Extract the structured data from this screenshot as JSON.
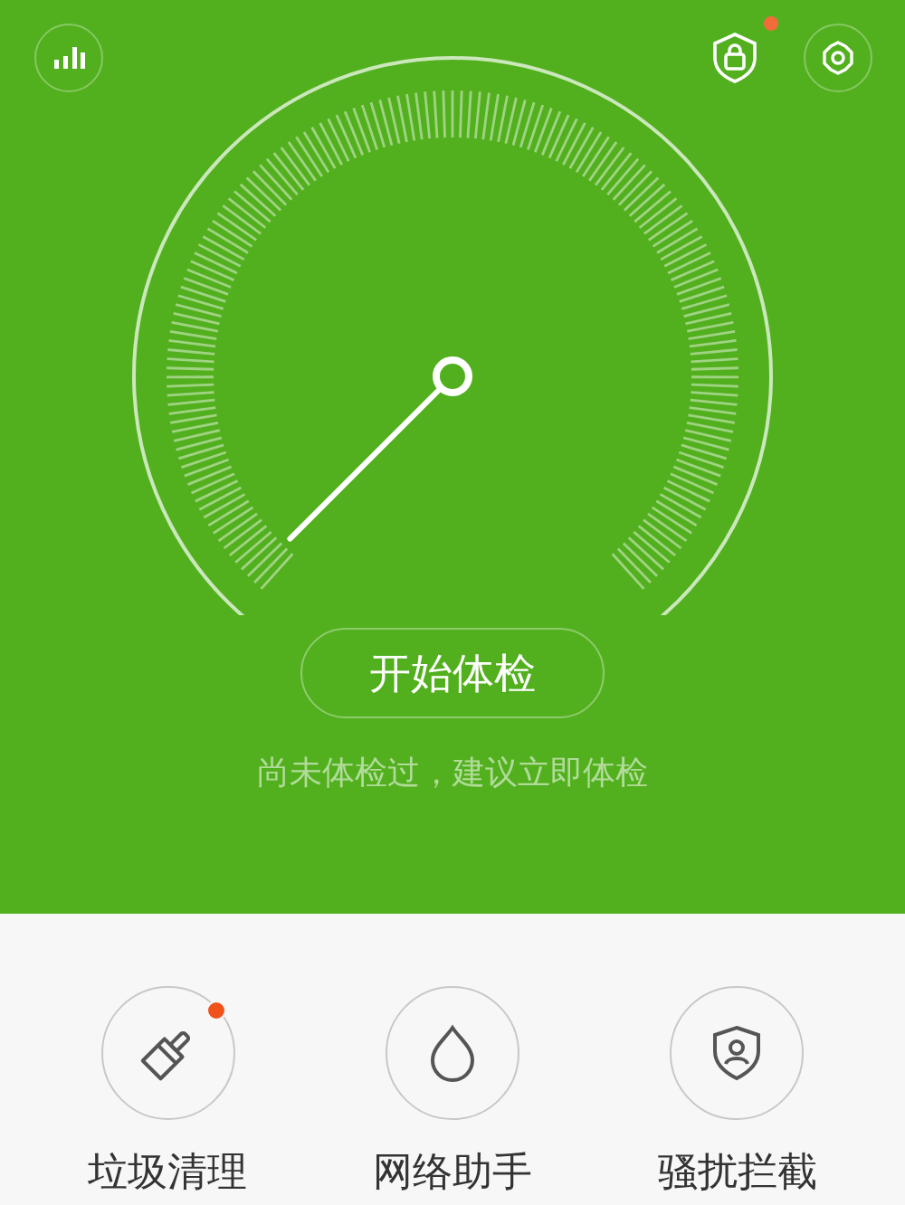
{
  "top_bar": {
    "left": {
      "kind": "stats",
      "badge": false
    },
    "right": [
      {
        "kind": "lock",
        "badge": true
      },
      {
        "kind": "settings",
        "badge": false
      }
    ]
  },
  "start_button": "开始体检",
  "hint": "尚未体检过，建议立即体检",
  "tools": [
    {
      "kind": "clean",
      "label": "垃圾清理",
      "badge": true
    },
    {
      "kind": "network",
      "label": "网络助手",
      "badge": false
    },
    {
      "kind": "block",
      "label": "骚扰拦截",
      "badge": false
    }
  ]
}
